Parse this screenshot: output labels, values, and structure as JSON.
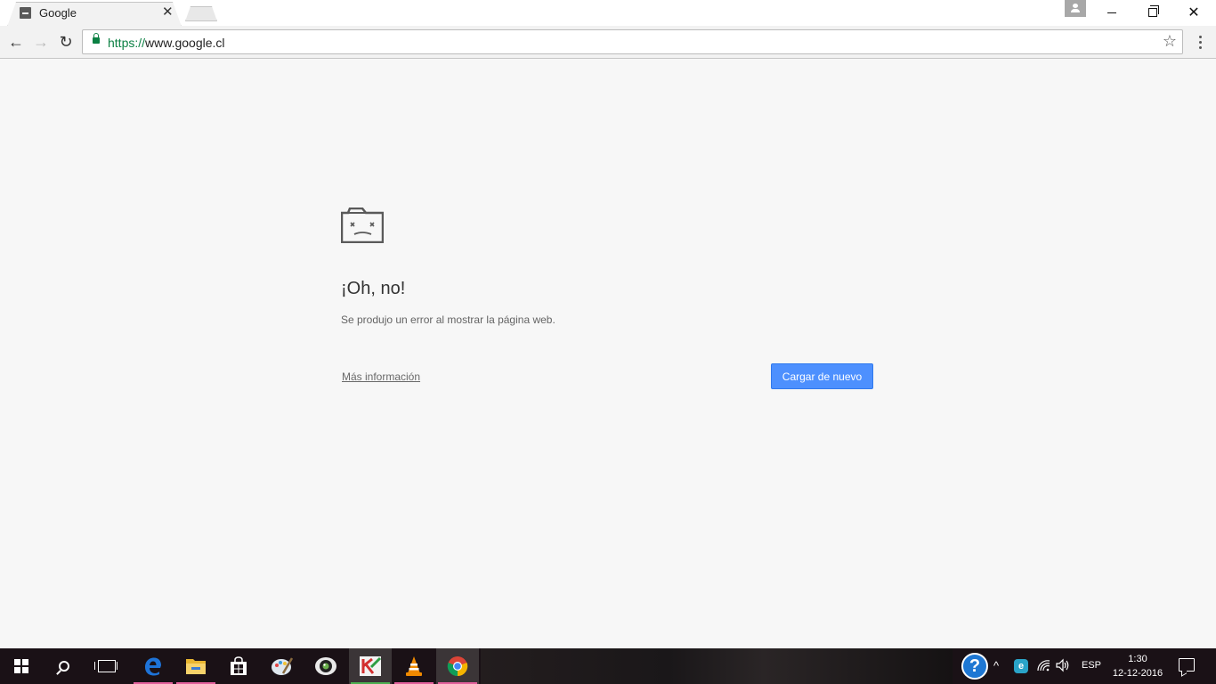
{
  "browser": {
    "tab": {
      "title": "Google",
      "close_glyph": "✕",
      "favicon": "sad-page-favicon-icon"
    },
    "window_controls": {
      "minimize": "minimize-icon",
      "maximize": "restore-icon",
      "close_glyph": "✕"
    },
    "toolbar": {
      "back_glyph": "←",
      "forward_glyph": "→",
      "reload_glyph": "↻",
      "url_scheme": "https://",
      "url_host": "www.google.cl",
      "star_glyph": "☆"
    }
  },
  "error_page": {
    "icon": "sad-tab-icon",
    "title": "¡Oh, no!",
    "description": "Se produjo un error al mostrar la página web.",
    "more_info_link": "Más información",
    "reload_button": "Cargar de nuevo"
  },
  "taskbar": {
    "apps": [
      {
        "name": "edge",
        "glyph": "e",
        "color": "#1e73d8",
        "underline": "#e2609c"
      },
      {
        "name": "file-explorer",
        "glyph": "",
        "color": "#f2c12e",
        "underline": "#e2609c"
      },
      {
        "name": "store",
        "glyph": "",
        "color": "#ffffff",
        "underline": ""
      },
      {
        "name": "paint",
        "glyph": "",
        "color": "#6fa8dc",
        "underline": ""
      },
      {
        "name": "camera-app",
        "glyph": "",
        "color": "#111111",
        "underline": ""
      },
      {
        "name": "kaspersky",
        "glyph": "K",
        "color": "#cf2b2b",
        "underline": "#4caf50"
      },
      {
        "name": "vlc",
        "glyph": "",
        "color": "#f08a00",
        "underline": "#e2609c"
      },
      {
        "name": "chrome",
        "glyph": "",
        "color": "#db4437",
        "underline": "#e2609c"
      }
    ],
    "tray": {
      "help_glyph": "?",
      "chevron_glyph": "^",
      "app_glyph": "e",
      "wifi_glyph": "◝",
      "volume_glyph": "🔈",
      "language": "ESP",
      "time": "1:30",
      "date": "12-12-2016"
    }
  }
}
